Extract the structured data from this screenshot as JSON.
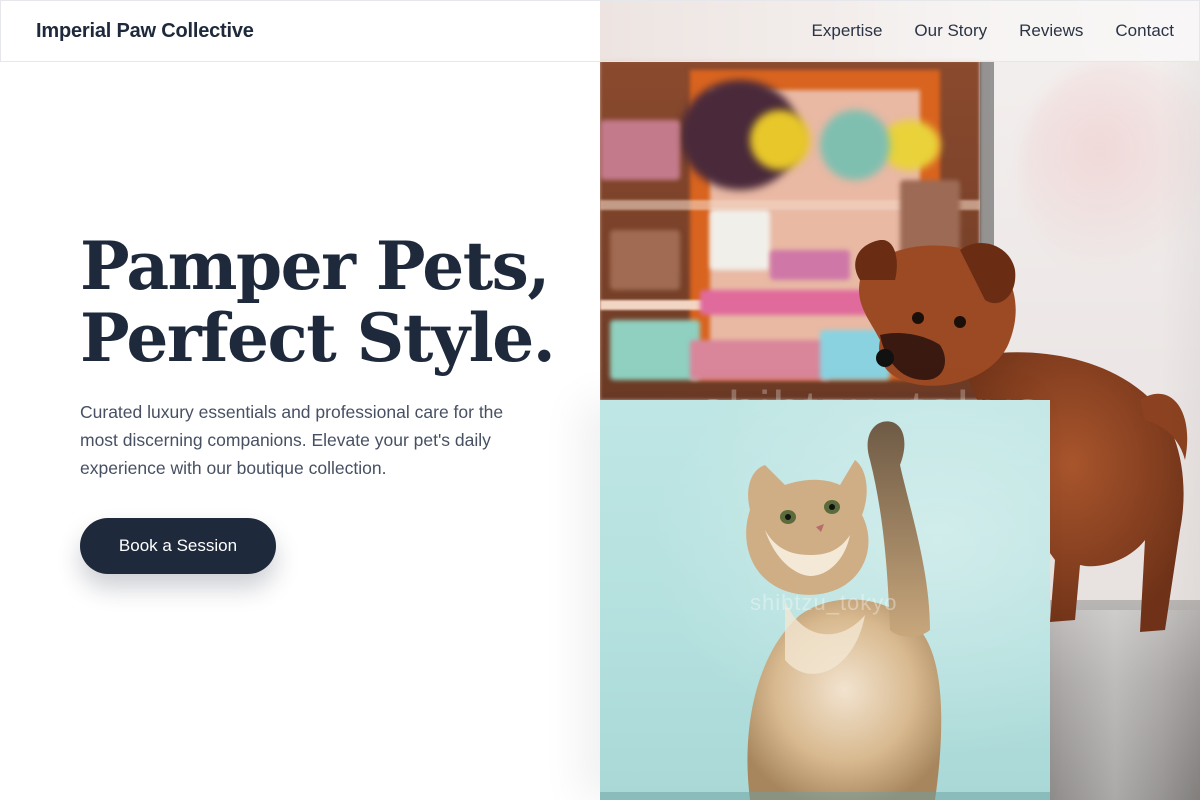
{
  "brand": {
    "name": "Imperial Paw Collective"
  },
  "nav": {
    "items": [
      {
        "label": "Expertise"
      },
      {
        "label": "Our Story"
      },
      {
        "label": "Reviews"
      },
      {
        "label": "Contact"
      }
    ]
  },
  "hero": {
    "title_line1": "Pamper Pets,",
    "title_line2": "Perfect Style.",
    "description": "Curated luxury essentials and professional care for the most discerning companions. Elevate your pet's daily experience with our boutique collection.",
    "cta_label": "Book a Session"
  },
  "images": {
    "main_photo": "dog-in-pet-boutique-photo",
    "inset_photo": "kitten-raising-paw-photo",
    "watermark_main": "shibtzu_tokyo",
    "watermark_inset": "shibtzu_tokyo"
  },
  "colors": {
    "primary": "#1e293b",
    "text_muted": "#475063",
    "background": "#ffffff",
    "inset_bg": "#b3e0de"
  }
}
